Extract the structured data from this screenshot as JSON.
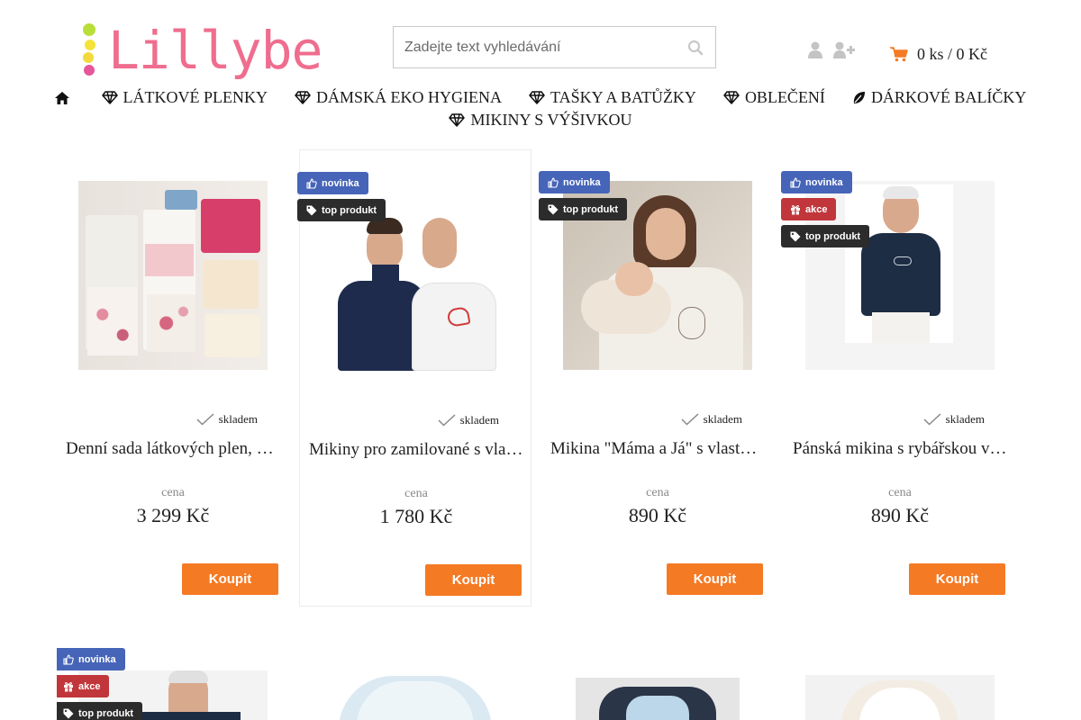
{
  "brand": {
    "logo_text": "Lillybe"
  },
  "search": {
    "placeholder": "Zadejte text vyhledávání"
  },
  "cart": {
    "summary": "0 ks / 0 Kč"
  },
  "nav": {
    "items": [
      {
        "label": "LÁTKOVÉ PLENKY",
        "icon": "diamond-icon"
      },
      {
        "label": "DÁMSKÁ EKO HYGIENA",
        "icon": "diamond-icon"
      },
      {
        "label": "TAŠKY A BATŮŽKY",
        "icon": "diamond-icon"
      },
      {
        "label": "OBLEČENÍ",
        "icon": "diamond-icon"
      },
      {
        "label": "DÁRKOVÉ BALÍČKY",
        "icon": "leaf-icon"
      },
      {
        "label": "MIKINY S VÝŠIVKOU",
        "icon": "diamond-icon"
      }
    ]
  },
  "labels": {
    "new": "novinka",
    "sale": "akce",
    "top": "top produkt",
    "stock": "skladem",
    "price": "cena",
    "buy": "Koupit"
  },
  "products": [
    {
      "name": "Denní sada látkových plen, vhodná od narození",
      "price": "3 299 Kč",
      "flags": []
    },
    {
      "name": "Mikiny pro zamilované s vlastním textem",
      "price": "1 780 Kč",
      "flags": [
        "new",
        "top"
      ]
    },
    {
      "name": "Mikina \"Máma a Já\" s vlastním textem",
      "price": "890 Kč",
      "flags": [
        "new",
        "top"
      ]
    },
    {
      "name": "Pánská mikina s rybářskou výšivkou",
      "price": "890 Kč",
      "flags": [
        "new",
        "sale",
        "top"
      ]
    }
  ],
  "row2_flags": [
    "new",
    "sale",
    "top"
  ],
  "colors": {
    "accent": "#f57a24",
    "brand_pink": "#ef6d8e",
    "badge_new": "#4664b8",
    "badge_sale": "#c0363b",
    "badge_top": "#2c2c2c"
  }
}
